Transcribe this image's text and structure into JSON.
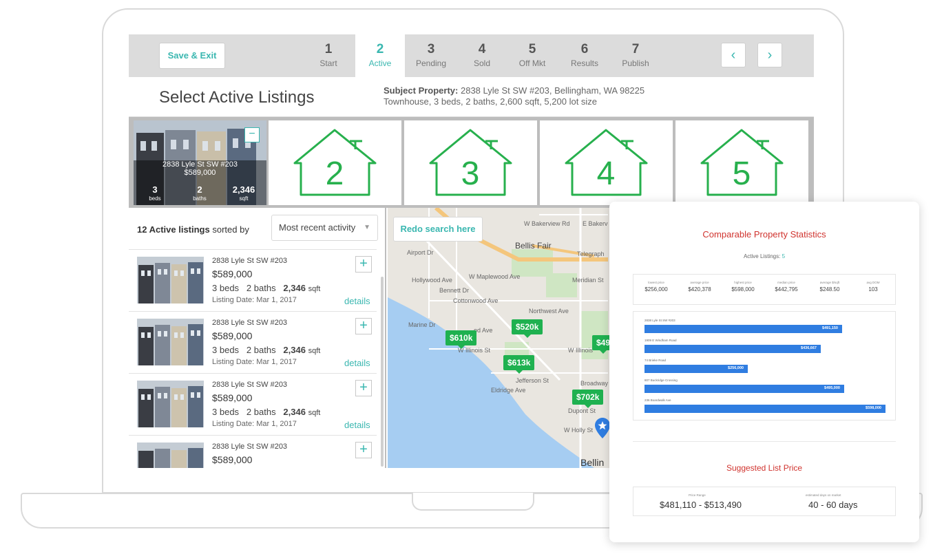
{
  "header": {
    "save_exit": "Save & Exit",
    "steps": [
      {
        "num": "1",
        "label": "Start"
      },
      {
        "num": "2",
        "label": "Active"
      },
      {
        "num": "3",
        "label": "Pending"
      },
      {
        "num": "4",
        "label": "Sold"
      },
      {
        "num": "5",
        "label": "Off Mkt"
      },
      {
        "num": "6",
        "label": "Results"
      },
      {
        "num": "7",
        "label": "Publish"
      }
    ],
    "prev_icon": "‹",
    "next_icon": "›"
  },
  "page": {
    "title": "Select Active Listings",
    "subject_label": "Subject Property:",
    "subject_address": "2838 Lyle St SW #203, Bellingham, WA 98225",
    "subject_details": "Townhouse, 3 beds, 2 baths, 2,600 sqft, 5,200 lot size"
  },
  "comparables": {
    "selected": {
      "address": "2838 Lyle St SW #203",
      "price": "$589,000",
      "beds": "3",
      "beds_label": "beds",
      "baths": "2",
      "baths_label": "baths",
      "sqft": "2,346",
      "sqft_label": "sqft",
      "remove_icon": "−"
    },
    "slots": [
      "2",
      "3",
      "4",
      "5"
    ]
  },
  "listings": {
    "count_label": "12 Active listings",
    "sorted_by": "sorted by",
    "sort_value": "Most recent activity",
    "items": [
      {
        "address": "2838 Lyle St SW #203",
        "price": "$589,000",
        "beds": "3",
        "beds_label": "beds",
        "baths": "2",
        "baths_label": "baths",
        "sqft": "2,346",
        "sqft_label": "sqft",
        "date": "Listing Date: Mar 1, 2017",
        "details": "details",
        "add": "+"
      },
      {
        "address": "2838 Lyle St SW #203",
        "price": "$589,000",
        "beds": "3",
        "beds_label": "beds",
        "baths": "2",
        "baths_label": "baths",
        "sqft": "2,346",
        "sqft_label": "sqft",
        "date": "Listing Date: Mar 1, 2017",
        "details": "details",
        "add": "+"
      },
      {
        "address": "2838 Lyle St SW #203",
        "price": "$589,000",
        "beds": "3",
        "beds_label": "beds",
        "baths": "2",
        "baths_label": "baths",
        "sqft": "2,346",
        "sqft_label": "sqft",
        "date": "Listing Date: Mar 1, 2017",
        "details": "details",
        "add": "+"
      },
      {
        "address": "2838 Lyle St SW #203",
        "price": "$589,000",
        "add": "+"
      }
    ]
  },
  "map": {
    "redo": "Redo search here",
    "labels": [
      "W Bakerview Rd",
      "E Bakerv",
      "Bellis Fair",
      "Telegraph",
      "Airport Dr",
      "W Maplewood Ave",
      "Hollywood Ave",
      "Bennett Dr",
      "Cottonwood Ave",
      "Northwest Ave",
      "Meridian St",
      "Marine Dr",
      "od Ave",
      "W Illinois St",
      "W Illinois",
      "Jefferson St",
      "Eldridge Ave",
      "Broadway",
      "Dupont St",
      "W Holly St",
      "Bellin"
    ],
    "pins": [
      "$610k",
      "$520k",
      "$613k",
      "$702k",
      "$49"
    ]
  },
  "stats": {
    "title": "Comparable Property Statistics",
    "active_label": "Active Listings:",
    "active_count": "5",
    "columns": [
      {
        "key": "lowest price",
        "value": "$256,000"
      },
      {
        "key": "average price",
        "value": "$420,378"
      },
      {
        "key": "highest price",
        "value": "$598,000"
      },
      {
        "key": "median price",
        "value": "$442,795"
      },
      {
        "key": "average $/sqft",
        "value": "$248.50"
      },
      {
        "key": "avg DOM",
        "value": "103"
      }
    ],
    "bars": [
      {
        "label": "2838 Lyle St SW #203",
        "value": "$491,150",
        "amount": 491150
      },
      {
        "label": "1909 E Windham Road",
        "value": "$436,667",
        "amount": 436667
      },
      {
        "label": "74 Brieke Road",
        "value": "$256,000",
        "amount": 256000
      },
      {
        "label": "807 Buckridge Crossing",
        "value": "$495,000",
        "amount": 495000
      },
      {
        "label": "236 Boardwalk Ave",
        "value": "$598,000",
        "amount": 598000
      }
    ],
    "suggest_title": "Suggested List Price",
    "price_range_label": "Price Range",
    "price_range": "$481,110 - $513,490",
    "dom_label": "estimated days on market",
    "dom": "40 - 60 days"
  },
  "colors": {
    "accent": "#3ab7b0",
    "pin": "#1fb150",
    "bar": "#2f7de1",
    "title_red": "#d0332e",
    "house_outline": "#27b04d"
  }
}
